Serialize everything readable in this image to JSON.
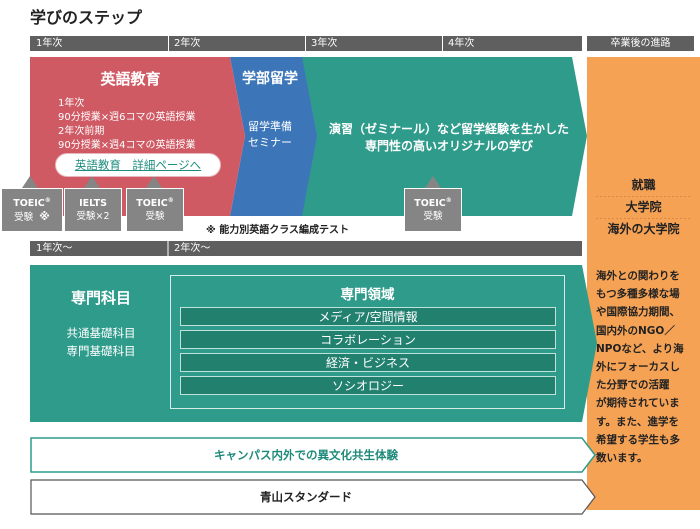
{
  "title": "学びのステップ",
  "top_bar": {
    "year1": "1年次",
    "year2": "2年次",
    "year3": "3年次",
    "year4": "4年次"
  },
  "career_header": "卒業後の進路",
  "english": {
    "title": "英語教育",
    "lines": [
      "1年次",
      "90分授業×週6コマの英語授業",
      "2年次前期",
      "90分授業×週4コマの英語授業"
    ],
    "link": "英語教育　詳細ページへ"
  },
  "study_abroad": {
    "title": "学部留学",
    "lines": [
      "留学準備",
      "セミナー"
    ]
  },
  "seminar": {
    "lines": [
      "演習（ゼミナール）など留学経験を生かした",
      "専門性の高いオリジナルの学び"
    ]
  },
  "badges": [
    {
      "name": "TOEIC",
      "mark": "®",
      "sub": "受験",
      "note": "※"
    },
    {
      "name": "IELTS",
      "mark": "",
      "sub": "受験×2",
      "note": ""
    },
    {
      "name": "TOEIC",
      "mark": "®",
      "sub": "受験",
      "note": ""
    },
    {
      "name": "TOEIC",
      "mark": "®",
      "sub": "受験",
      "note": ""
    }
  ],
  "note1": "※ 能力別英語クラス編成テスト",
  "second_bar": {
    "year1": "1年次〜",
    "year2": "2年次〜"
  },
  "major": {
    "title": "専門科目",
    "subs": [
      "共通基礎科目",
      "専門基礎科目"
    ]
  },
  "fields": {
    "title": "専門領域",
    "items": [
      "メディア/空間情報",
      "コラボレーション",
      "経済・ビジネス",
      "ソシオロジー"
    ]
  },
  "campus": "キャンパス内外での異文化共生体験",
  "aoyama": "青山スタンダード",
  "career": {
    "items": [
      "就職",
      "大学院",
      "海外の大学院"
    ],
    "desc_lines": [
      "海外との関わりを",
      "もつ多種多様な場",
      "や国際協力期間、",
      "国内外のNGO／",
      "NPOなど、より海",
      "外にフォーカスし",
      "た分野での活躍",
      "が期待されていま",
      "す。また、進学を",
      "希望する学生も多",
      "数います。"
    ]
  },
  "colors": {
    "english": "#cf5a64",
    "study_abroad": "#3c76b9",
    "teal": "#2f9b8b",
    "field_item": "#22806f",
    "orange": "#f5a255",
    "bar": "#5f5f5f",
    "badge": "#858585"
  }
}
